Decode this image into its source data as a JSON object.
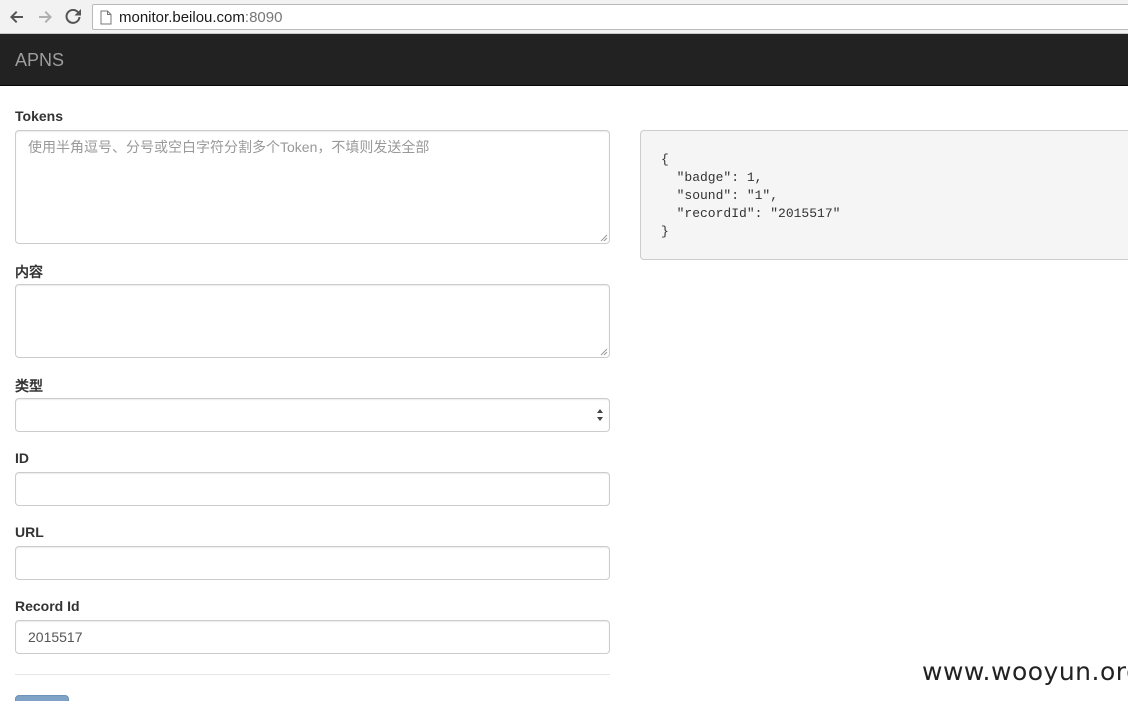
{
  "browser": {
    "url_host": "monitor.beilou.com",
    "url_port": ":8090"
  },
  "navbar": {
    "brand": "APNS"
  },
  "form": {
    "tokens": {
      "label": "Tokens",
      "placeholder": "使用半角逗号、分号或空白字符分割多个Token，不填则发送全部",
      "value": ""
    },
    "content": {
      "label": "内容",
      "value": ""
    },
    "type": {
      "label": "类型",
      "selected": ""
    },
    "id": {
      "label": "ID",
      "value": ""
    },
    "url": {
      "label": "URL",
      "value": ""
    },
    "record_id": {
      "label": "Record Id",
      "value": "2015517"
    }
  },
  "preview": {
    "json_text": "{\n  \"badge\": 1,\n  \"sound\": \"1\",\n  \"recordId\": \"2015517\"\n}"
  },
  "watermark": "www.wooyun.org",
  "icons": {
    "back": "back-arrow-icon",
    "forward": "forward-arrow-icon",
    "reload": "reload-icon",
    "page": "page-icon"
  }
}
